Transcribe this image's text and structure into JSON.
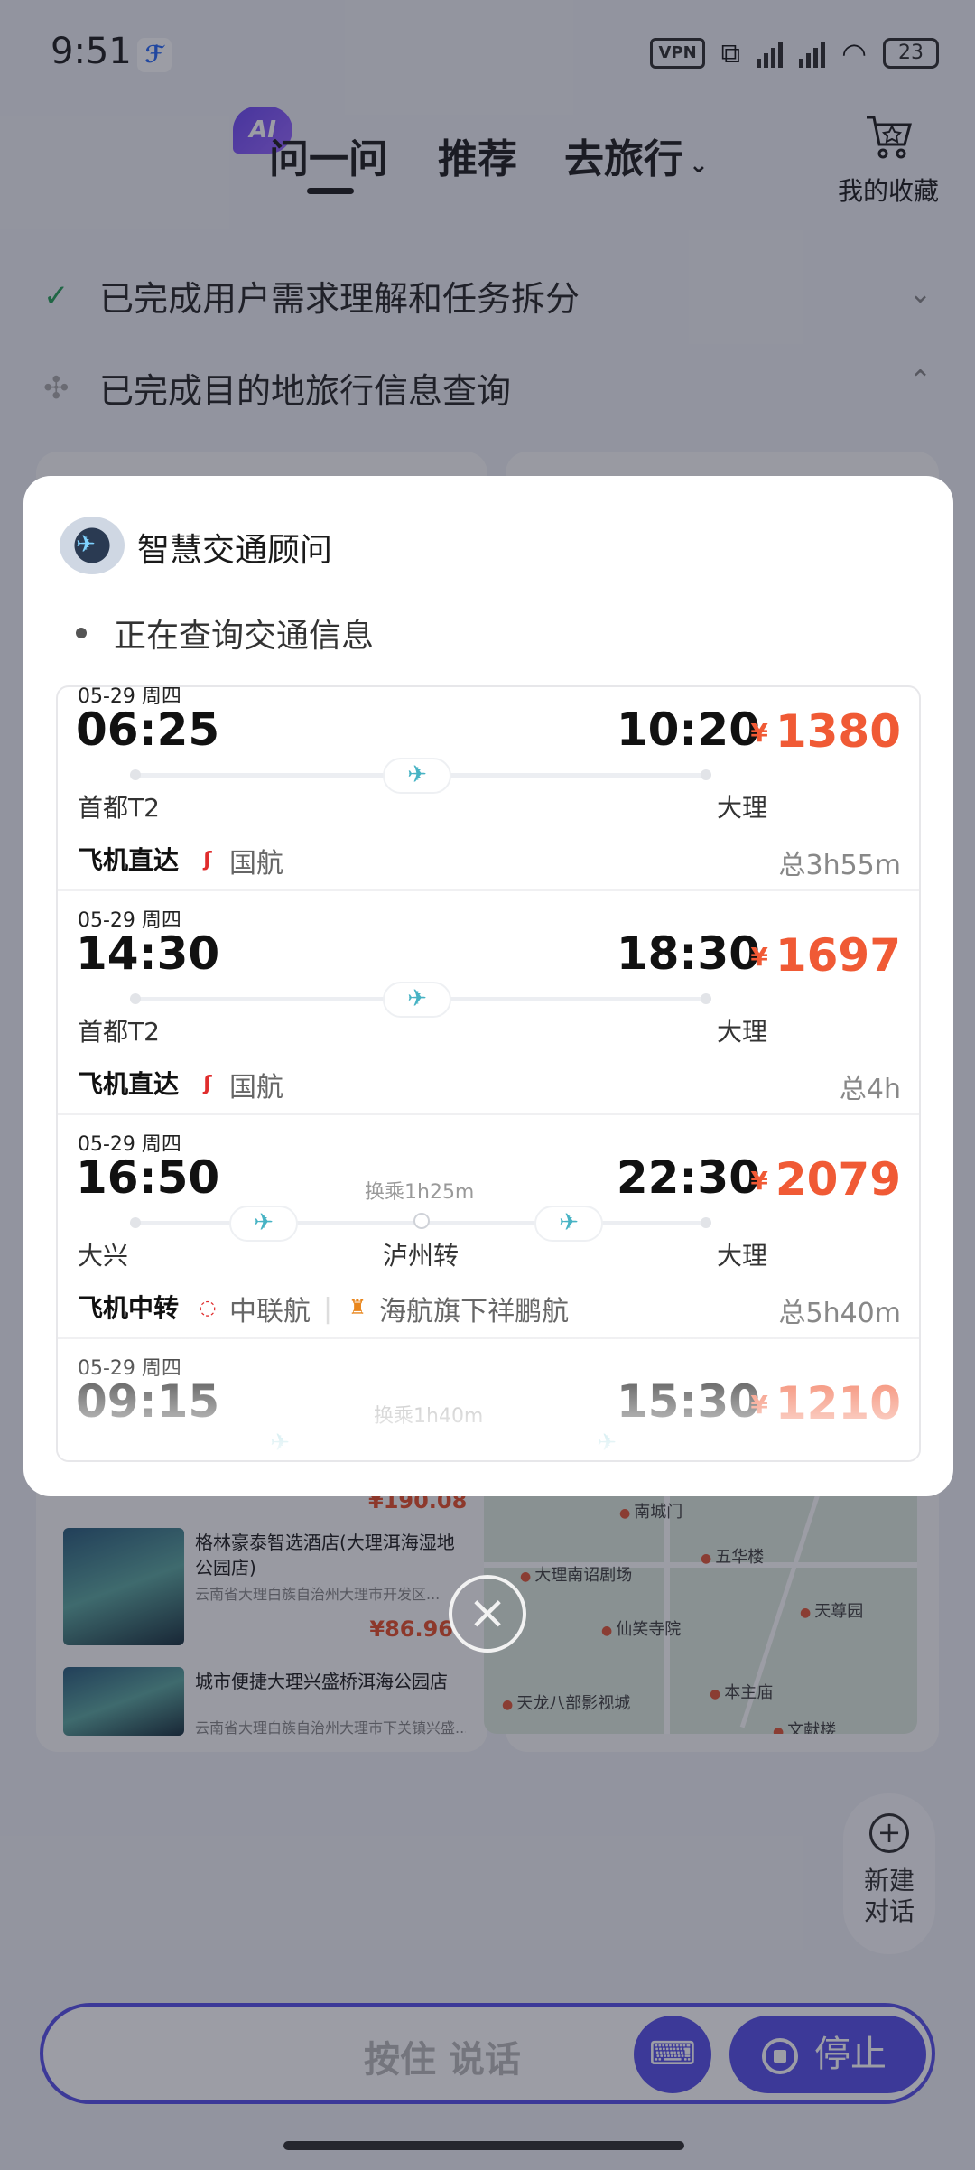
{
  "status_bar": {
    "time": "9:51",
    "vpn": "VPN",
    "battery": "23"
  },
  "header": {
    "ai_badge": "AI",
    "tabs": [
      {
        "label": "问一问"
      },
      {
        "label": "推荐"
      },
      {
        "label": "去旅行"
      }
    ],
    "favorites_label": "我的收藏"
  },
  "progress": [
    {
      "label": "已完成用户需求理解和任务拆分"
    },
    {
      "label": "已完成目的地旅行信息查询"
    }
  ],
  "hotels": [
    {
      "name": "格林豪泰智选酒店(大理洱海湿地公园店)",
      "address": "云南省大理白族自治州大理市开发区...",
      "price": "¥86.96"
    },
    {
      "name": "城市便捷大理兴盛桥洱海公园店",
      "address": "云南省大理白族自治州大理市下关镇兴盛...",
      "price": ""
    }
  ],
  "hotel_top_price": "¥190.08",
  "map_pois": [
    "大理南诏剧场",
    "五华楼",
    "仙笑寺院",
    "本主庙",
    "天龙八部影视城",
    "文献楼",
    "天尊园",
    "南城门"
  ],
  "modal": {
    "advisor_name": "智慧交通顾问",
    "status": "正在查询交通信息",
    "flights": [
      {
        "date": "05-29 周四",
        "dep_time": "06:25",
        "arr_time": "10:20",
        "price": "1380",
        "dep_airport": "首都T2",
        "arr_airport": "大理",
        "type": "飞机直达",
        "airlines": [
          "国航"
        ],
        "duration": "总3h55m",
        "via": "",
        "transfer": ""
      },
      {
        "date": "05-29 周四",
        "dep_time": "14:30",
        "arr_time": "18:30",
        "price": "1697",
        "dep_airport": "首都T2",
        "arr_airport": "大理",
        "type": "飞机直达",
        "airlines": [
          "国航"
        ],
        "duration": "总4h",
        "via": "",
        "transfer": ""
      },
      {
        "date": "05-29 周四",
        "dep_time": "16:50",
        "arr_time": "22:30",
        "price": "2079",
        "dep_airport": "大兴",
        "arr_airport": "大理",
        "type": "飞机中转",
        "airlines": [
          "中联航",
          "海航旗下祥鹏航"
        ],
        "duration": "总5h40m",
        "via": "泸州转",
        "transfer": "换乘1h25m"
      },
      {
        "date": "05-29 周四",
        "dep_time": "09:15",
        "arr_time": "15:30",
        "price": "1210",
        "dep_airport": "",
        "arr_airport": "",
        "type": "",
        "airlines": [],
        "duration": "",
        "via": "",
        "transfer": "换乘1h40m"
      }
    ],
    "currency": "¥",
    "close_icon": "close-icon"
  },
  "new_chat_label": "新建对话",
  "input": {
    "hold_to_talk": "按住 说话",
    "stop_label": "停止"
  },
  "colors": {
    "accent": "#5b53e8",
    "price": "#f05a35",
    "plane": "#47b3c4"
  }
}
